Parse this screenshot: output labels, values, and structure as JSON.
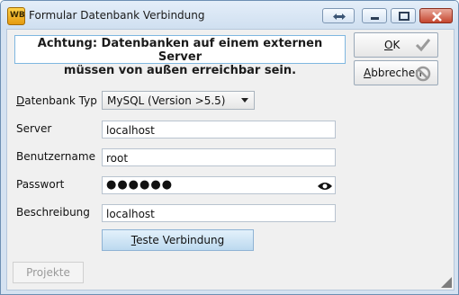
{
  "window": {
    "title": "Formular Datenbank Verbindung",
    "app_icon_text": "WB"
  },
  "warning": {
    "line1": "Achtung: Datenbanken auf einem externen Server",
    "line2": "müssen von außen erreichbar sein."
  },
  "buttons": {
    "ok_mnemonic": "O",
    "ok_rest": "K",
    "cancel_mnemonic": "A",
    "cancel_rest": "bbrechen",
    "test_mnemonic": "T",
    "test_rest": "este Verbindung",
    "projects_label": "Projekte"
  },
  "form": {
    "db_type_label_mnemonic": "D",
    "db_type_label_rest": "atenbank Typ",
    "db_type_value": "MySQL (Version >5.5)",
    "server_label": "Server",
    "server_value": "localhost",
    "user_label": "Benutzername",
    "user_value": "root",
    "password_label": "Passwort",
    "password_masked": "●●●●●●",
    "description_label": "Beschreibung",
    "description_value": "localhost"
  },
  "icons": {
    "ok": "checkmark-icon",
    "cancel": "prohibited-icon",
    "password": "eye-icon"
  }
}
